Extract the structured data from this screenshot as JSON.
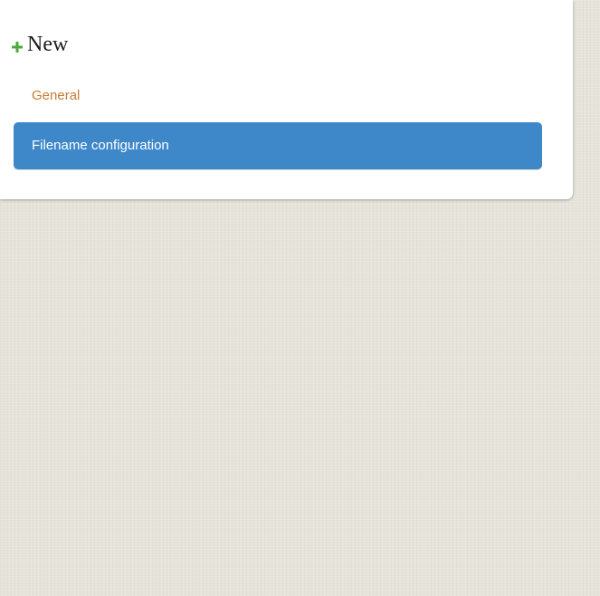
{
  "menu": {
    "new_label": "New",
    "items": [
      {
        "label": "General",
        "active": false
      },
      {
        "label": "Filename configuration",
        "active": true
      }
    ]
  },
  "icons": {
    "new": "plus-icon"
  },
  "colors": {
    "plus_icon": "#4caa3c",
    "link": "#c57d32",
    "active_item": "#3e87c9",
    "background": "#e6e4da",
    "panel": "#ffffff"
  }
}
